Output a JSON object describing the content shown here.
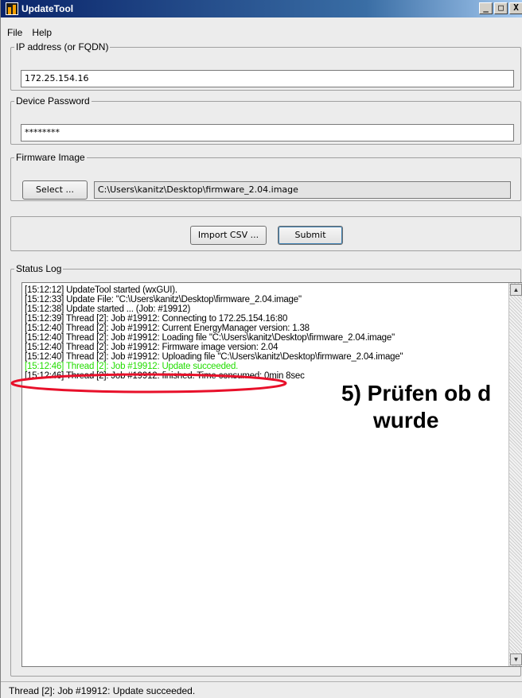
{
  "window": {
    "title": "UpdateTool",
    "minimize": "_",
    "maximize": "□",
    "close": "X"
  },
  "menu": {
    "file": "File",
    "help": "Help"
  },
  "ip_group": {
    "legend": "IP address (or FQDN)",
    "value": "172.25.154.16"
  },
  "password_group": {
    "legend": "Device Password",
    "value": "********"
  },
  "firmware_group": {
    "legend": "Firmware Image",
    "select_label": "Select ...",
    "path": "C:\\Users\\kanitz\\Desktop\\firmware_2.04.image"
  },
  "actions": {
    "import_label": "Import CSV ...",
    "submit_label": "Submit"
  },
  "status_log": {
    "legend": "Status Log",
    "lines": [
      "[15:12:12] UpdateTool started (wxGUI).",
      "[15:12:33] Update File: \"C:\\Users\\kanitz\\Desktop\\firmware_2.04.image\"",
      "[15:12:38] Update started ... (Job: #19912)",
      "[15:12:39] Thread [2]: Job #19912: Connecting to 172.25.154.16:80",
      "[15:12:40] Thread [2]: Job #19912: Current EnergyManager version: 1.38",
      "[15:12:40] Thread [2]: Job #19912: Loading file \"C:\\Users\\kanitz\\Desktop\\firmware_2.04.image\"",
      "[15:12:40] Thread [2]: Job #19912: Firmware image version: 2.04",
      "[15:12:40] Thread [2]: Job #19912: Uploading file \"C:\\Users\\kanitz\\Desktop\\firmware_2.04.image\"",
      "[15:12:46] Thread [2]: Job #19912: Update succeeded.",
      "[15:12:46] Thread [2]: Job #19912: finished. Time consumed: 0min 8sec"
    ],
    "scroll_up": "▲",
    "scroll_down": "▼"
  },
  "annotation": {
    "line1": "5) Prüfen ob d",
    "line2": "wurde",
    "highlight_color": "#e8102a"
  },
  "statusbar": {
    "text": "Thread [2]: Job #19912: Update succeeded."
  }
}
